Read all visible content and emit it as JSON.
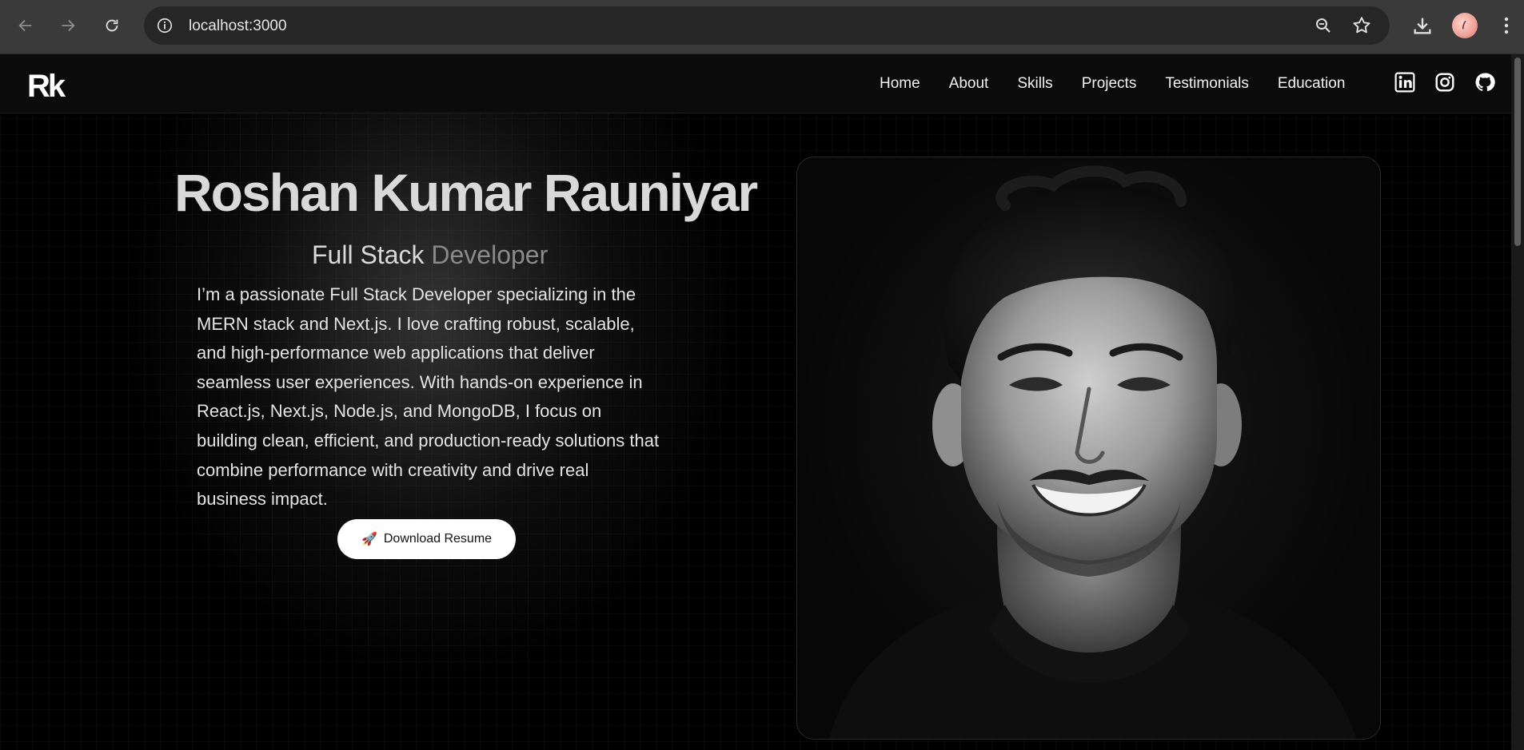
{
  "browser": {
    "url": "localhost:3000"
  },
  "navbar": {
    "logo": "Rk",
    "links": [
      "Home",
      "About",
      "Skills",
      "Projects",
      "Testimonials",
      "Education"
    ],
    "socials": [
      "linkedin-icon",
      "instagram-icon",
      "github-icon"
    ]
  },
  "hero": {
    "name": "Roshan Kumar Rauniyar",
    "role_part1": "Full Stack",
    "role_part2": "Developer",
    "bio": "I’m a passionate Full Stack Developer specializing in the MERN stack and Next.js. I love crafting robust, scalable, and high-performance web applications that deliver seamless user experiences. With hands-on experience in React.js, Next.js, Node.js, and MongoDB, I focus on building clean, efficient, and production-ready solutions that combine performance with creativity and drive real business impact.",
    "button_icon": "🚀",
    "button_label": "Download Resume"
  },
  "colors": {
    "background": "#000000",
    "navbar": "#0b0b0b",
    "text": "#e4e4e4",
    "role_muted": "#8a8a8a",
    "button_bg": "#ffffff"
  }
}
